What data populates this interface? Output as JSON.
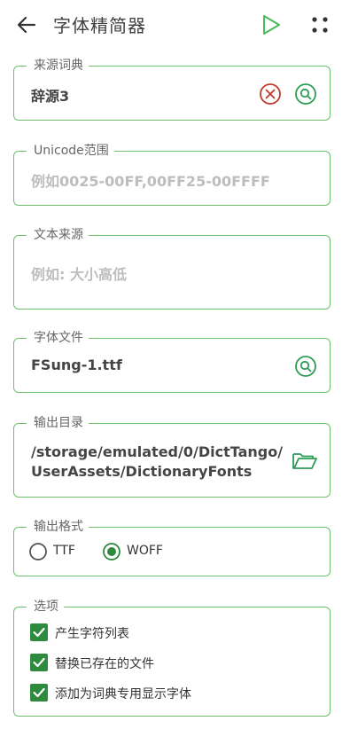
{
  "appbar": {
    "title": "字体精简器",
    "back_icon": "arrow-left-icon",
    "run_icon": "play-icon",
    "more_icon": "dots-grid-icon",
    "accent": "#4cb85c"
  },
  "source_dict": {
    "label": "来源词典",
    "value": "辞源3",
    "clear_icon": "clear-circle-icon",
    "search_icon": "search-icon"
  },
  "unicode_range": {
    "label": "Unicode范围",
    "placeholder": "例如0025-00FF,00FF25-00FFFF"
  },
  "text_source": {
    "label": "文本来源",
    "placeholder": "例如: 大小高低"
  },
  "font_file": {
    "label": "字体文件",
    "value": "FSung-1.ttf",
    "search_icon": "search-icon"
  },
  "output_dir": {
    "label": "输出目录",
    "line1": "/storage/emulated/0/DictTango/",
    "line2": "UserAssets/DictionaryFonts",
    "folder_icon": "folder-open-icon"
  },
  "output_format": {
    "label": "输出格式",
    "options": [
      {
        "label": "TTF",
        "selected": false
      },
      {
        "label": "WOFF",
        "selected": true
      }
    ]
  },
  "options": {
    "label": "选项",
    "items": [
      {
        "label": "产生字符列表",
        "checked": true
      },
      {
        "label": "替换已存在的文件",
        "checked": true
      },
      {
        "label": "添加为词典专用显示字体",
        "checked": true
      }
    ]
  },
  "colors": {
    "border": "#6dc06d",
    "checkbox": "#2e8b3e",
    "clear": "#c0392b"
  }
}
